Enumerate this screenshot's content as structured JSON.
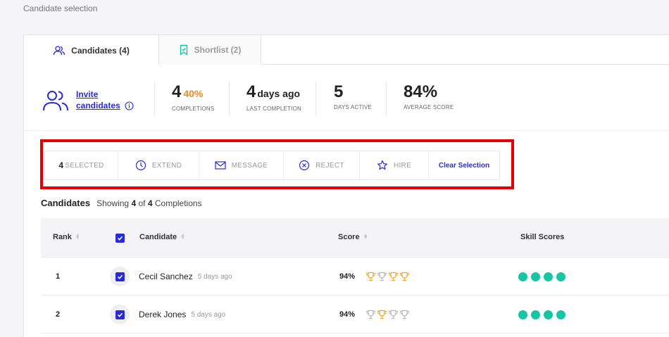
{
  "page": {
    "title": "Candidate selection"
  },
  "tabs": [
    {
      "label": "Candidates (4)",
      "active": true,
      "icon": "users-icon"
    },
    {
      "label": "Shortlist (2)",
      "active": false,
      "icon": "bookmark-icon"
    }
  ],
  "invite": {
    "line1": "Invite",
    "line2": "candidates",
    "icon": "users-icon",
    "info_icon": "info-icon"
  },
  "stats": [
    {
      "value": "4",
      "extra": "40%",
      "label": "COMPLETIONS"
    },
    {
      "value": "4",
      "extra": "days ago",
      "label": "LAST COMPLETION"
    },
    {
      "value": "5",
      "extra": "",
      "label": "DAYS ACTIVE"
    },
    {
      "value": "84%",
      "extra": "",
      "label": "AVERAGE SCORE"
    }
  ],
  "actions": {
    "selected_count": "4",
    "selected_label": "SELECTED",
    "extend": "EXTEND",
    "message": "MESSAGE",
    "reject": "REJECT",
    "hire": "HIRE",
    "clear": "Clear Selection"
  },
  "candidates_header": {
    "title": "Candidates",
    "showing_prefix": "Showing",
    "shown": "4",
    "of": "of",
    "total": "4",
    "suffix": "Completions"
  },
  "table": {
    "columns": {
      "rank": "Rank",
      "candidate": "Candidate",
      "score": "Score",
      "skills": "Skill Scores"
    },
    "rows": [
      {
        "rank": "1",
        "name": "Cecil Sanchez",
        "ago": "5 days ago",
        "score": "94%",
        "trophies": [
          "gold",
          "gray",
          "gold",
          "gold"
        ],
        "skill_dots": 4,
        "checked": true
      },
      {
        "rank": "2",
        "name": "Derek Jones",
        "ago": "5 days ago",
        "score": "94%",
        "trophies": [
          "gray",
          "gold",
          "gray",
          "gray"
        ],
        "skill_dots": 4,
        "checked": true
      }
    ]
  },
  "colors": {
    "accent": "#2b2bd6",
    "orange": "#f08a1a",
    "teal": "#16c5a3",
    "highlight": "#e30000",
    "gold": "#e8a93a",
    "gray_trophy": "#b8b8bc"
  }
}
